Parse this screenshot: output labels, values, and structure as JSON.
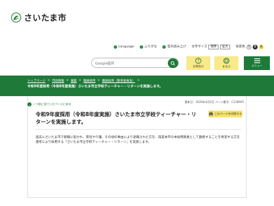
{
  "logo": {
    "text": "さいたま市"
  },
  "util": {
    "language": "Language",
    "furigana": "ふりがな",
    "read_aloud": "音声読み上げ",
    "font_size_label": "文字サイズ",
    "font_standard": "標準",
    "font_large": "拡大",
    "bg_color_label": "背景色",
    "bg_white": "白",
    "bg_black": "黒",
    "bg_blue": "青"
  },
  "search": {
    "placeholder": "Google提供"
  },
  "quick": {
    "help_label": "お問合せ",
    "manabu_label": "まなぶ",
    "menu_label": "メニュー"
  },
  "breadcrumb": {
    "items": [
      "トップページ",
      "市政情報",
      "募集",
      "職員採用",
      "職員採用（教育委員会）"
    ],
    "current": "令和9年度採用（令和8年度実施）さいたま市立学校ティーチャー・リターンを実施します。"
  },
  "page": {
    "back_link": "一つ前に見ていたページに戻る",
    "meta": "更新日：2026年4月2日 ページ番号：C128695",
    "title": "令和9年度採用（令和8年度実施）さいたま市立学校ティーチャー・リターンを実施します。",
    "print_label": "このページを印刷する",
    "body": "過去にさいたま市で教職に就かれ、育児や介護、その他の事由により退職された方を、再度本市の本採用教員として勤務することを希望する方を選考により採用する「さいたま市立学校ティーチャー・リターン」を実施します。"
  },
  "colors": {
    "brand_green": "#1f7a3a",
    "accent_yellow": "#f8e98a"
  }
}
